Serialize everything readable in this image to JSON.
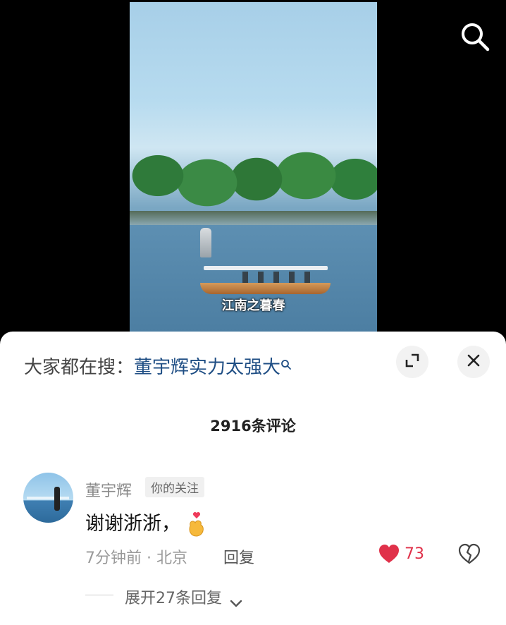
{
  "video": {
    "caption": "江南之暮春"
  },
  "top_bar": {
    "search_icon": "search-icon"
  },
  "hot_search": {
    "prefix": "大家都在搜：",
    "term": "董宇辉实力太强大"
  },
  "comments_header": {
    "count_label": "2916条评论"
  },
  "comment": {
    "username": "董宇辉",
    "tag": "你的关注",
    "text": "谢谢浙浙，",
    "time_location": "7分钟前 · 北京",
    "reply_label": "回复",
    "like_count": "73",
    "expand_label": "展开27条回复"
  },
  "colors": {
    "accent_link": "#1f4e84",
    "like_red": "#e0314a"
  }
}
